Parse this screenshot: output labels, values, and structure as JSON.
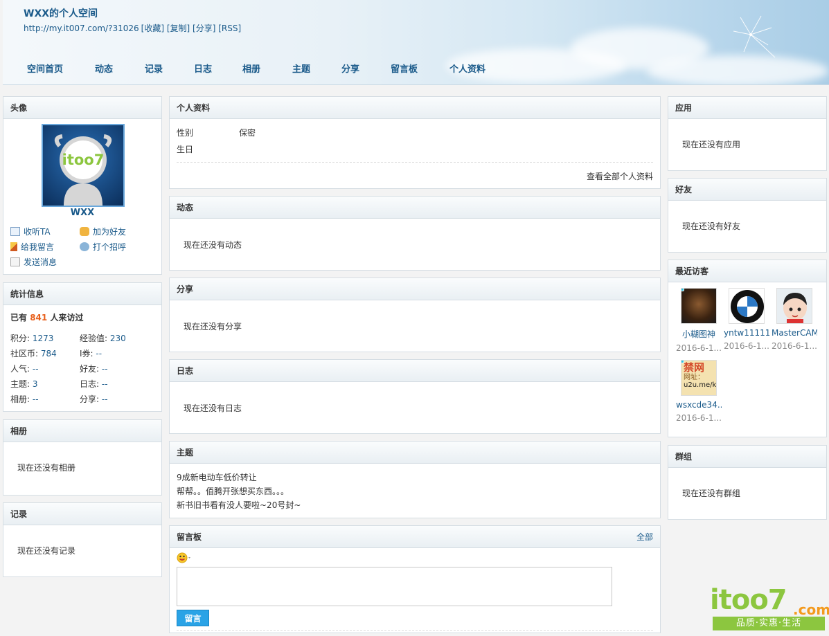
{
  "header": {
    "title": "WXX的个人空间",
    "url": "http://my.it007.com/?31026",
    "links": [
      "[收藏]",
      "[复制]",
      "[分享]",
      "[RSS]"
    ]
  },
  "nav": [
    "空间首页",
    "动态",
    "记录",
    "日志",
    "相册",
    "主题",
    "分享",
    "留言板",
    "个人资料"
  ],
  "avatar_panel": {
    "title": "头像",
    "logo_text": "itoo7",
    "username": "WXX",
    "actions": [
      "收听TA",
      "加为好友",
      "给我留言",
      "打个招呼",
      "发送消息"
    ]
  },
  "stats": {
    "title": "统计信息",
    "visits_prefix": "已有",
    "visits": "841",
    "visits_suffix": "人来访过",
    "items": [
      {
        "label": "积分:",
        "value": "1273"
      },
      {
        "label": "经验值:",
        "value": "230"
      },
      {
        "label": "社区币:",
        "value": "784"
      },
      {
        "label": "I券:",
        "value": "--"
      },
      {
        "label": "人气:",
        "value": "--"
      },
      {
        "label": "好友:",
        "value": "--"
      },
      {
        "label": "主题:",
        "value": "3"
      },
      {
        "label": "日志:",
        "value": "--"
      },
      {
        "label": "相册:",
        "value": "--"
      },
      {
        "label": "分享:",
        "value": "--"
      }
    ]
  },
  "album": {
    "title": "相册",
    "empty": "现在还没有相册"
  },
  "records": {
    "title": "记录",
    "empty": "现在还没有记录"
  },
  "profile": {
    "title": "个人资料",
    "gender_label": "性别",
    "gender_value": "保密",
    "birthday_label": "生日",
    "view_all": "查看全部个人资料"
  },
  "feed": {
    "title": "动态",
    "empty": "现在还没有动态"
  },
  "share": {
    "title": "分享",
    "empty": "现在还没有分享"
  },
  "blog": {
    "title": "日志",
    "empty": "现在还没有日志"
  },
  "topics": {
    "title": "主题",
    "items": [
      "9成新电动车低价转让",
      "帮帮。。佰腾开张想买东西。。。",
      "新书旧书看有没人要啦~20号封~"
    ]
  },
  "guestbook": {
    "title": "留言板",
    "all": "全部",
    "submit": "留言"
  },
  "apps": {
    "title": "应用",
    "empty": "现在还没有应用"
  },
  "friends": {
    "title": "好友",
    "empty": "现在还没有好友"
  },
  "visitors": {
    "title": "最近访客",
    "items": [
      {
        "name": "小糊图神",
        "date": "2016-6-1..."
      },
      {
        "name": "yntw11111",
        "date": "2016-6-1..."
      },
      {
        "name": "MasterCAM",
        "date": "2016-6-1..."
      },
      {
        "name": "wsxcde34...",
        "date": "2016-6-1...",
        "avatar_text": [
          "禁网",
          "网址：",
          "u2u.me/k"
        ]
      }
    ]
  },
  "groups": {
    "title": "群组",
    "empty": "现在还没有群组"
  },
  "watermark": {
    "brand": "itoo7",
    "domain": ".com",
    "slogan": "品质·实惠·生活"
  },
  "colors": {
    "link": "#1a5a8a",
    "highlight": "#e8601c",
    "button": "#2aa3e6",
    "watermark_green": "#8cc63f",
    "watermark_orange": "#f39a1e"
  }
}
